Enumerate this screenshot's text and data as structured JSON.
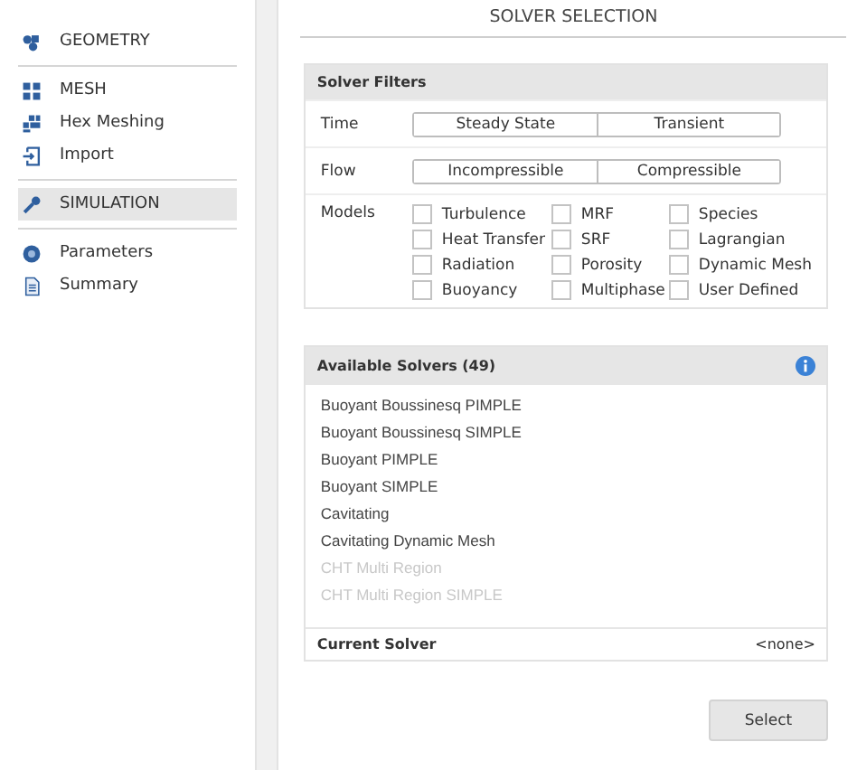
{
  "sidebar": {
    "groups": [
      {
        "items": [
          {
            "label": "GEOMETRY",
            "kind": "geometry",
            "selected": false
          }
        ]
      },
      {
        "items": [
          {
            "label": "MESH",
            "kind": "grid",
            "selected": false
          },
          {
            "label": "Hex Meshing",
            "kind": "hex",
            "selected": false
          },
          {
            "label": "Import",
            "kind": "import",
            "selected": false
          }
        ]
      },
      {
        "items": [
          {
            "label": "SIMULATION",
            "kind": "wrench",
            "selected": true
          }
        ]
      },
      {
        "items": [
          {
            "label": "Parameters",
            "kind": "params",
            "selected": false
          },
          {
            "label": "Summary",
            "kind": "doc",
            "selected": false
          }
        ]
      }
    ]
  },
  "header": {
    "title": "SOLVER SELECTION"
  },
  "filters": {
    "title": "Solver Filters",
    "rows": [
      {
        "label": "Time",
        "options": [
          {
            "label": "Steady State",
            "selected": false
          },
          {
            "label": "Transient",
            "selected": false
          }
        ]
      },
      {
        "label": "Flow",
        "options": [
          {
            "label": "Incompressible",
            "selected": false
          },
          {
            "label": "Compressible",
            "selected": false
          }
        ]
      }
    ],
    "models_label": "Models",
    "models": [
      {
        "label": "Turbulence",
        "checked": false
      },
      {
        "label": "MRF",
        "checked": false
      },
      {
        "label": "Species",
        "checked": false
      },
      {
        "label": "Heat Transfer",
        "checked": false
      },
      {
        "label": "SRF",
        "checked": false
      },
      {
        "label": "Lagrangian",
        "checked": false
      },
      {
        "label": "Radiation",
        "checked": false
      },
      {
        "label": "Porosity",
        "checked": false
      },
      {
        "label": "Dynamic Mesh",
        "checked": false
      },
      {
        "label": "Buoyancy",
        "checked": false
      },
      {
        "label": "Multiphase",
        "checked": false
      },
      {
        "label": "User Defined",
        "checked": false
      }
    ]
  },
  "solvers": {
    "title": "Available Solvers (49)",
    "items": [
      {
        "label": "Buoyant Boussinesq PIMPLE",
        "disabled": false
      },
      {
        "label": "Buoyant Boussinesq SIMPLE",
        "disabled": false
      },
      {
        "label": "Buoyant PIMPLE",
        "disabled": false
      },
      {
        "label": "Buoyant SIMPLE",
        "disabled": false
      },
      {
        "label": "Cavitating",
        "disabled": false
      },
      {
        "label": "Cavitating Dynamic Mesh",
        "disabled": false
      },
      {
        "label": "CHT Multi Region",
        "disabled": true
      },
      {
        "label": "CHT Multi Region SIMPLE",
        "disabled": true
      }
    ],
    "current_label": "Current Solver",
    "current_value": "<none>"
  },
  "buttons": [
    "Select"
  ]
}
